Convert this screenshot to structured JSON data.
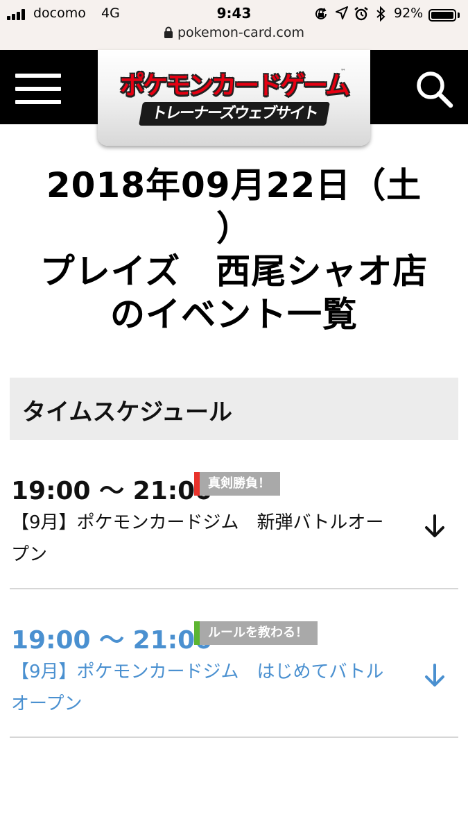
{
  "status_bar": {
    "carrier": "docomo",
    "network": "4G",
    "time": "9:43",
    "battery_percent": "92%",
    "icons": [
      "orientation-lock-icon",
      "location-icon",
      "alarm-icon",
      "bluetooth-icon"
    ]
  },
  "browser": {
    "url": "pokemon-card.com"
  },
  "header": {
    "logo_title": "ポケモンカードゲーム",
    "logo_subtitle": "トレーナーズウェブサイト",
    "logo_tm": "™",
    "menu_icon": "hamburger-menu-icon",
    "search_icon": "search-icon"
  },
  "page": {
    "title_line1": "2018年09月22日（土",
    "title_line2": "）",
    "title_line3": "プレイズ　西尾シャオ店",
    "title_line4": "のイベント一覧"
  },
  "schedule": {
    "heading": "タイムスケジュール",
    "events": [
      {
        "time": "19:00 ～ 21:00",
        "badge": "真剣勝負！",
        "badge_color": "#e8322b",
        "name": "【9月】ポケモンカードジム　新弾バトルオープン",
        "text_color": "#111111"
      },
      {
        "time": "19:00 ～ 21:00",
        "badge": "ルールを教わる！",
        "badge_color": "#5cb531",
        "name": "【9月】ポケモンカードジム　はじめてバトル　オープン",
        "text_color": "#4a90d0"
      }
    ]
  },
  "colors": {
    "header_bg": "#000000",
    "status_bg": "#f6f1ee",
    "section_bg": "#ececec",
    "link_blue": "#4a90d0"
  }
}
